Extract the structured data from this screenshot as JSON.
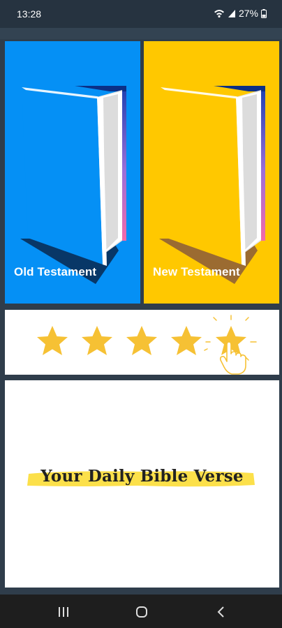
{
  "status": {
    "time": "13:28",
    "battery": "27%",
    "icons": [
      "wifi-icon",
      "signal-icon",
      "battery-icon"
    ]
  },
  "books": [
    {
      "label": "Old Testament",
      "bg": "#0590f5",
      "cover": "#0590f5"
    },
    {
      "label": "New Testament",
      "bg": "#ffc800",
      "cover": "#ffc800"
    }
  ],
  "rating": {
    "stars": 5,
    "icon": "star-icon",
    "hand_icon": "tap-hand-icon",
    "star_color": "#f6c134"
  },
  "verse": {
    "title": "Your Daily Bible Verse",
    "highlight_color": "#fce04a"
  },
  "nav": {
    "buttons": [
      "recent-apps-icon",
      "home-icon",
      "back-icon"
    ]
  }
}
